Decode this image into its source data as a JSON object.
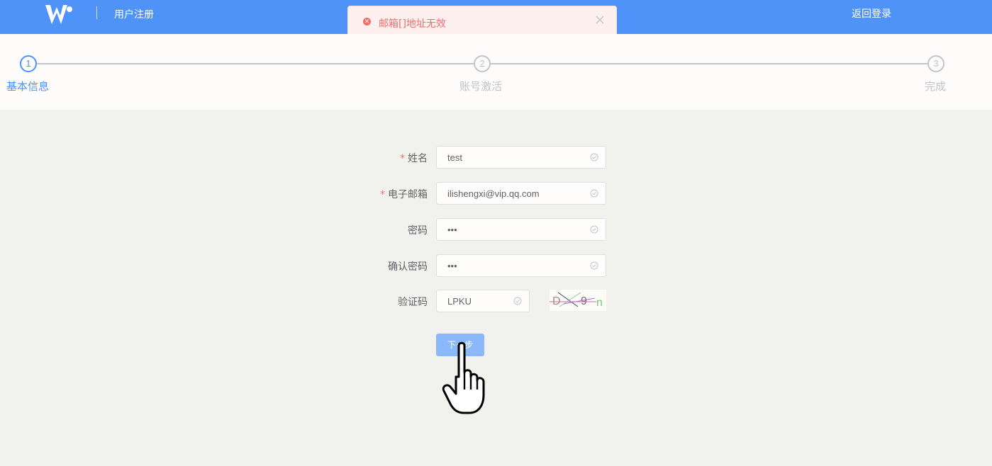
{
  "header": {
    "title": "用户注册",
    "back_login": "返回登录"
  },
  "toast": {
    "message": "邮箱[]地址无效",
    "type": "error"
  },
  "steps": [
    {
      "number": "1",
      "label": "基本信息",
      "active": true
    },
    {
      "number": "2",
      "label": "账号激活",
      "active": false
    },
    {
      "number": "3",
      "label": "完成",
      "active": false
    }
  ],
  "form": {
    "name": {
      "label": "姓名",
      "required": "*",
      "value": "test"
    },
    "email": {
      "label": "电子邮箱",
      "required": "*",
      "value": "ilishengxi@vip.qq.com"
    },
    "password": {
      "label": "密码",
      "value": "•••"
    },
    "confirm": {
      "label": "确认密码",
      "value": "•••"
    },
    "captcha": {
      "label": "验证码",
      "value": "LPKU",
      "image_text": "D 9 n"
    },
    "next_button": "下一步"
  },
  "colors": {
    "primary": "#4f93f9",
    "error": "#f56c6c",
    "button_disabled": "#8ab8fb",
    "background": "#f1f1ee"
  },
  "icons": [
    "logo-w-icon",
    "error-circle-icon",
    "close-icon",
    "check-circle-icon",
    "hand-pointer-cursor-icon"
  ]
}
